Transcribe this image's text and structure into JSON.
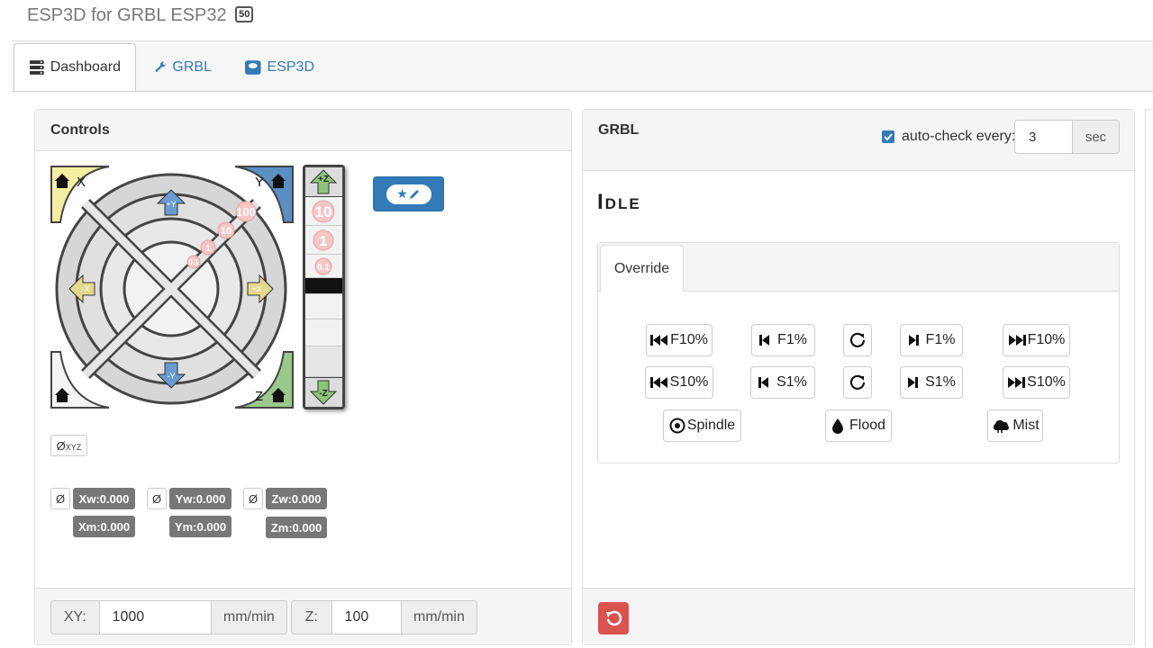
{
  "app": {
    "title": "ESP3D for GRBL ESP32",
    "version_badge": "50"
  },
  "tabs": [
    {
      "label": "Dashboard",
      "icon": "server-icon",
      "active": true
    },
    {
      "label": "GRBL",
      "icon": "wrench-icon",
      "active": false
    },
    {
      "label": "ESP3D",
      "icon": "esp-icon",
      "active": false
    }
  ],
  "controls": {
    "title": "Controls",
    "jog": {
      "home_x": "X",
      "home_y": "Y",
      "home_z": "Z",
      "plus_y": "+Y",
      "minus_y": "-Y",
      "plus_x": "+X",
      "minus_x": "-X",
      "plus_z": "+Z",
      "minus_z": "-Z",
      "step_100": "100",
      "step_10": "10",
      "step_1": "1",
      "step_01": "0.1",
      "z_10": "10",
      "z_1": "1",
      "z_01": "0.1"
    },
    "zero_all": {
      "symbol": "Ø",
      "sub": "XYZ"
    },
    "zero_symbol": "Ø",
    "positions": {
      "xw": "Xw:0.000",
      "yw": "Yw:0.000",
      "zw": "Zw:0.000",
      "xm": "Xm:0.000",
      "ym": "Ym:0.000",
      "zm": "Zm:0.000"
    },
    "feed": {
      "xy_label": "XY:",
      "xy_value": "1000",
      "xy_unit": "mm/min",
      "z_label": "Z:",
      "z_value": "100",
      "z_unit": "mm/min"
    }
  },
  "grbl": {
    "title": "GRBL",
    "auto_check_label": "auto-check every:",
    "auto_check_value": "3",
    "auto_check_unit": "sec",
    "status": "Idle",
    "override_tab": "Override",
    "overrides": {
      "f_minus10": "F10%",
      "f_minus1": "F1%",
      "f_plus1": "F1%",
      "f_plus10": "F10%",
      "s_minus10": "S10%",
      "s_minus1": "S1%",
      "s_plus1": "S1%",
      "s_plus10": "S10%",
      "spindle": "Spindle",
      "flood": "Flood",
      "mist": "Mist"
    }
  },
  "colors": {
    "primary": "#337ab7",
    "danger": "#d9534f",
    "home_x": "#f5eea0",
    "home_y": "#5b8ec3",
    "home_z": "#9cc88c"
  }
}
